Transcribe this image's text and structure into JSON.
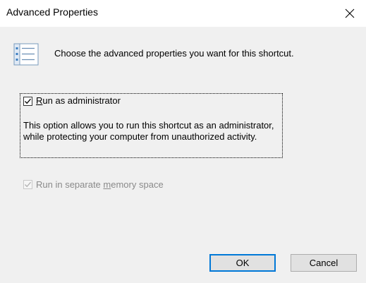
{
  "window": {
    "title": "Advanced Properties",
    "close_icon": "close-icon"
  },
  "header": {
    "icon": "properties-list-icon",
    "text": "Choose the advanced properties you want for this shortcut."
  },
  "options": {
    "run_as_admin": {
      "label_accel": "R",
      "label_rest": "un as administrator",
      "checked": true,
      "description": "This option allows you to run this shortcut as an administrator, while protecting your computer from unauthorized activity."
    },
    "separate_memory": {
      "label_before": "Run in separate ",
      "label_accel": "m",
      "label_after": "emory space",
      "checked": true,
      "disabled": true
    }
  },
  "buttons": {
    "ok": "OK",
    "cancel": "Cancel"
  },
  "colors": {
    "dialog_bg": "#f0f0f0",
    "titlebar_bg": "#ffffff",
    "focus_border": "#0078d7",
    "disabled_text": "#8a8a8a"
  }
}
